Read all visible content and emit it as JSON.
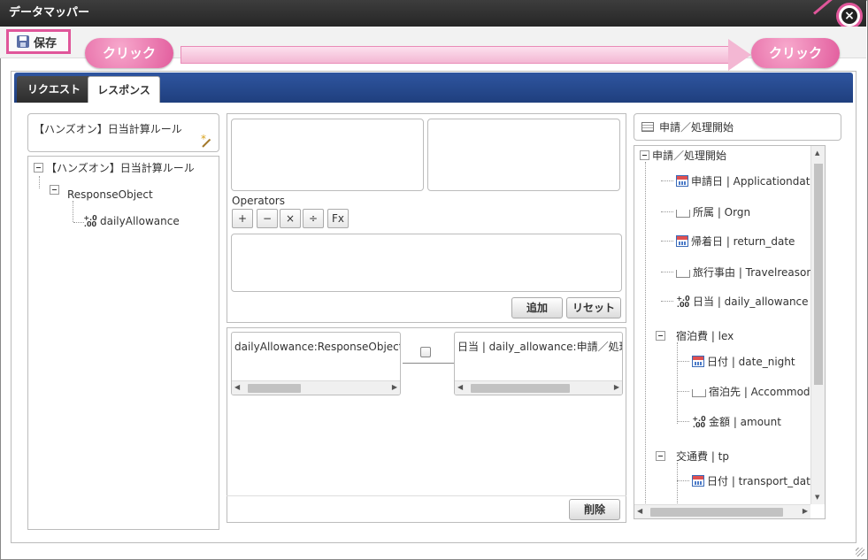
{
  "window": {
    "title": "データマッパー"
  },
  "toolbar": {
    "save_label": "保存"
  },
  "callouts": {
    "left": "クリック",
    "right": "クリック"
  },
  "tabs": [
    {
      "label": "リクエスト"
    },
    {
      "label": "レスポンス"
    }
  ],
  "left": {
    "rule_title": "【ハンズオン】日当計算ルール",
    "tree": {
      "root": "【ハンズオン】日当計算ルール",
      "child": "ResponseObject",
      "leaf": "dailyAllowance",
      "num_icon": "⁺.₀ .00"
    }
  },
  "center": {
    "operators_label": "Operators",
    "operators": [
      "+",
      "−",
      "×",
      "÷",
      "Fx"
    ],
    "add_label": "追加",
    "reset_label": "リセット",
    "mapping": {
      "source": "dailyAllowance:ResponseObject【",
      "target": "日当 | daily_allowance:申請／処理開"
    },
    "delete_label": "削除"
  },
  "right": {
    "title": "申請／処理開始",
    "tree": {
      "root": "申請／処理開始",
      "items": [
        "申請日 | Applicationdate",
        "所属 | Orgn",
        "帰着日 | return_date",
        "旅行事由 | Travelreason",
        "日当 | daily_allowance",
        "宿泊費 | lex",
        "日付 | date_night",
        "宿泊先 | Accommodati",
        "金額 | amount",
        "交通費 | tp",
        "日付 | transport_date"
      ]
    }
  }
}
